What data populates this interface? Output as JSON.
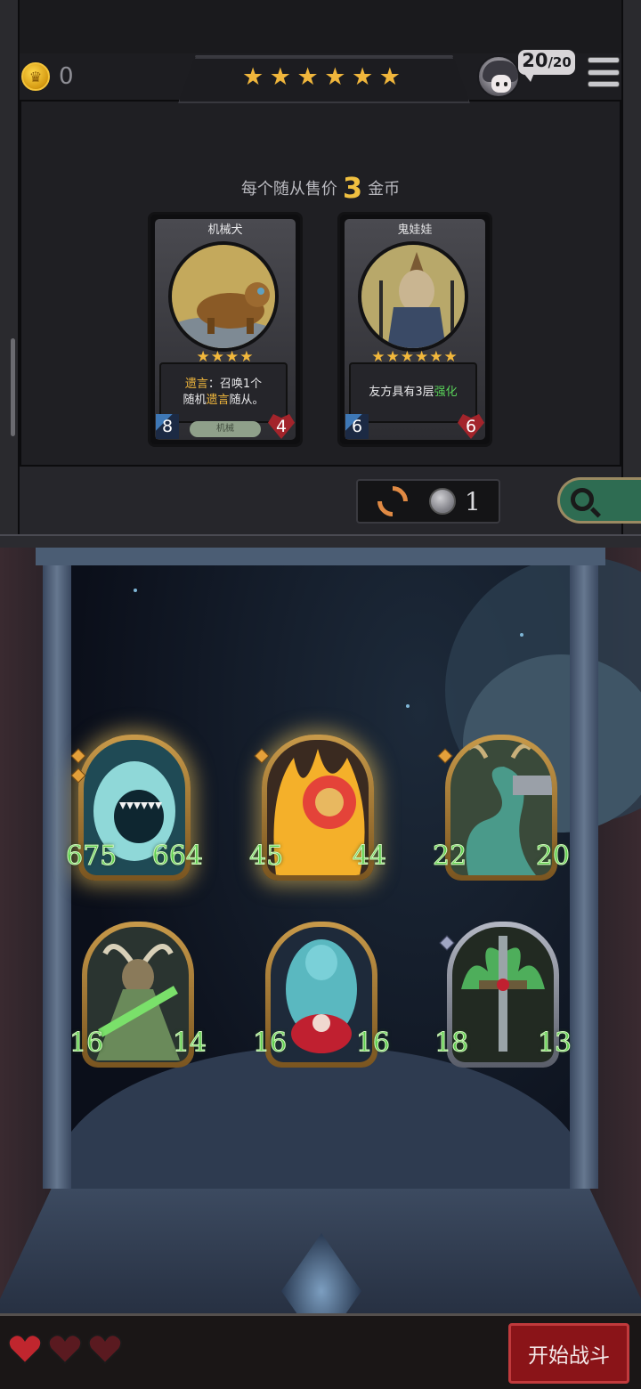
{
  "header": {
    "gold_value": "0",
    "tier_stars": [
      "★",
      "★",
      "★",
      "★",
      "★",
      "★"
    ],
    "turn_counter_current": "20",
    "turn_counter_max": "/20"
  },
  "shop": {
    "sell_prefix": "每个随从售价",
    "sell_price": "3",
    "sell_suffix": "金币",
    "cards": [
      {
        "name": "机械犬",
        "stars": "★★★★",
        "desc_line1_hl": "遗言",
        "desc_line1_rest": "：召唤1个",
        "desc_line2_pre": "随机",
        "desc_line2_hl": "遗言",
        "desc_line2_post": "随从。",
        "attack": "8",
        "health": "4",
        "tribe": "机械"
      },
      {
        "name": "鬼娃娃",
        "stars": "★★★★★★",
        "desc_pre": "友方具有3层",
        "desc_hl": "强化",
        "attack": "6",
        "health": "6"
      }
    ],
    "refresh_cost": "1"
  },
  "board": {
    "minions": [
      {
        "attack": "675",
        "health": "664"
      },
      {
        "attack": "45",
        "health": "44"
      },
      {
        "attack": "22",
        "health": "20"
      },
      {
        "attack": "16",
        "health": "14"
      },
      {
        "attack": "16",
        "health": "16"
      },
      {
        "attack": "18",
        "health": "13"
      }
    ]
  },
  "footer": {
    "lives": 3,
    "start_battle_label": "开始战斗"
  },
  "colors": {
    "gold_accent": "#f0b63c",
    "stat_green": "#5fcf4f",
    "start_button": "#8a1418"
  }
}
